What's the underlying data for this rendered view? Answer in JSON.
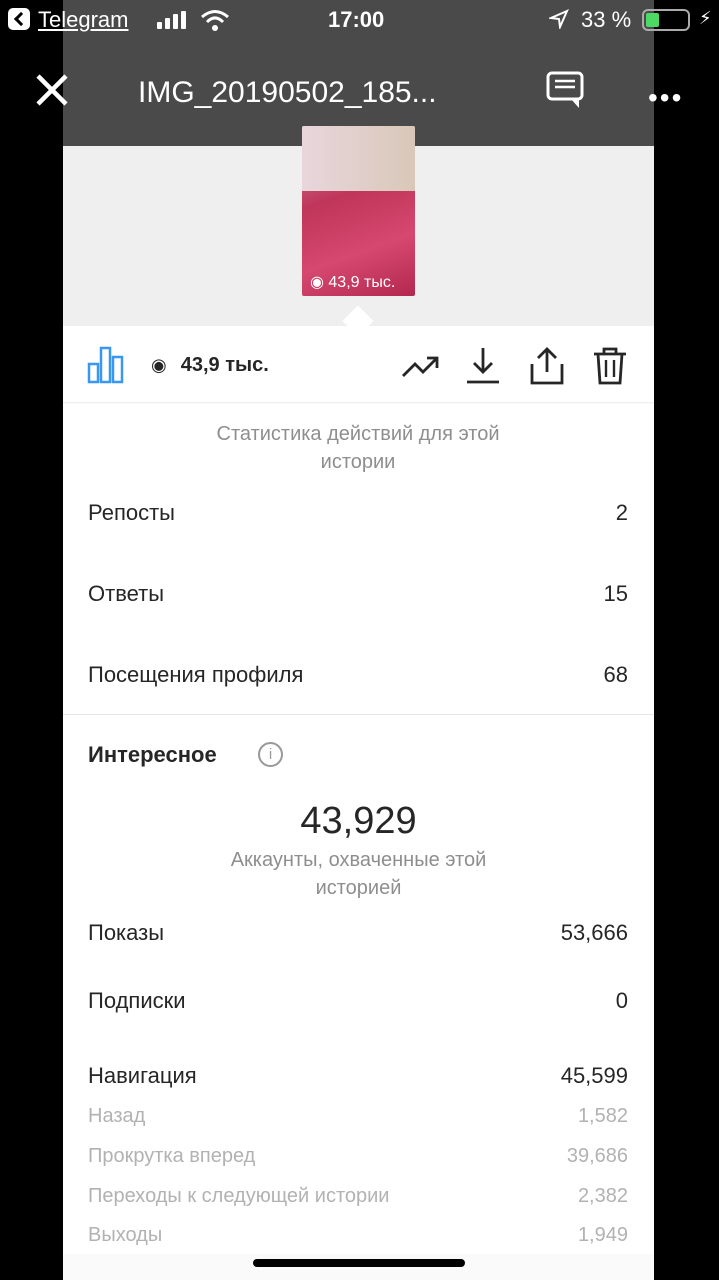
{
  "status_bar": {
    "back_app": "Telegram",
    "time": "17:00",
    "battery_percent": "33 %",
    "battery_level": 0.33
  },
  "viewer": {
    "file_name": "IMG_20190502_185...",
    "icons": [
      "close-icon",
      "share-icon",
      "more-icon"
    ]
  },
  "story": {
    "thumb_views": "43,9 тыс.",
    "views": "43,9 тыс.",
    "toolbar_icons": [
      "bar-chart-icon",
      "eye-icon",
      "trending-icon",
      "download-icon",
      "share-icon",
      "trash-icon"
    ]
  },
  "actions": {
    "caption": "Статистика действий для этой истории",
    "rows": [
      {
        "label": "Репосты",
        "value": "2"
      },
      {
        "label": "Ответы",
        "value": "15"
      },
      {
        "label": "Посещения профиля",
        "value": "68"
      }
    ]
  },
  "discovery": {
    "heading": "Интересное",
    "reach_value": "43,929",
    "reach_caption": "Аккаунты, охваченные этой историей",
    "rows": [
      {
        "label": "Показы",
        "value": "53,666"
      },
      {
        "label": "Подписки",
        "value": "0"
      },
      {
        "label": "Навигация",
        "value": "45,599"
      }
    ],
    "nav_rows": [
      {
        "label": "Назад",
        "value": "1,582"
      },
      {
        "label": "Прокрутка вперед",
        "value": "39,686"
      },
      {
        "label": "Переходы к следующей истории",
        "value": "2,382"
      },
      {
        "label": "Выходы",
        "value": "1,949"
      }
    ]
  },
  "colors": {
    "accent": "#3897f0",
    "battery_green": "#4cd964"
  }
}
